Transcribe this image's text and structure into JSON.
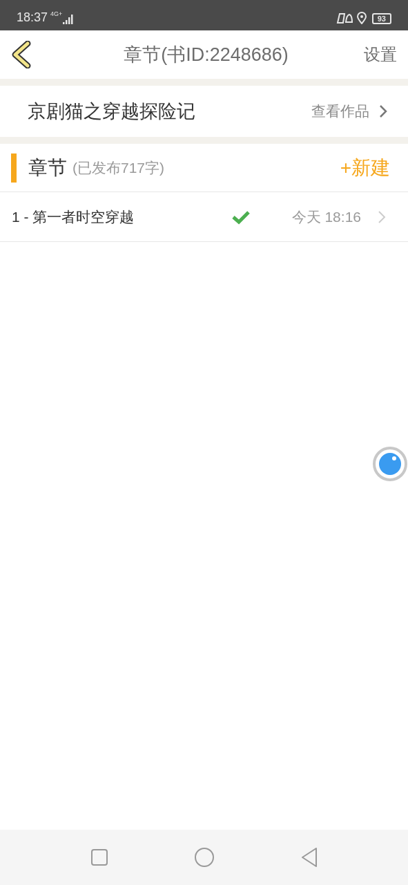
{
  "status_bar": {
    "time": "18:37",
    "network": "4G+",
    "battery": "93"
  },
  "nav": {
    "title": "章节(书ID:2248686)",
    "action": "设置"
  },
  "book": {
    "title": "京剧猫之穿越探险记",
    "link": "查看作品"
  },
  "section": {
    "title": "章节",
    "subtitle": "(已发布717字)",
    "action": "+新建"
  },
  "chapters": [
    {
      "title": "1 - 第一者时空穿越",
      "published": true,
      "time": "今天 18:16"
    }
  ]
}
